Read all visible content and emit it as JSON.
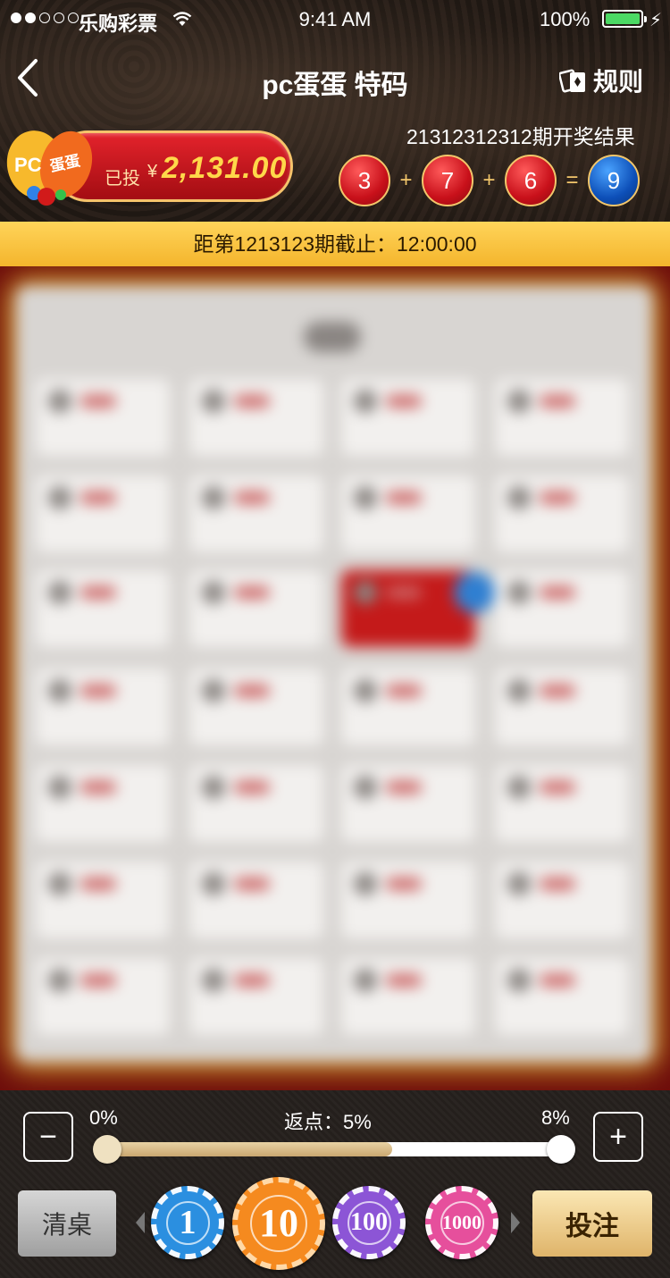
{
  "status_bar": {
    "carrier": "乐购彩票",
    "time": "9:41 AM",
    "battery": "100%"
  },
  "nav": {
    "title": "pc蛋蛋 特码",
    "rules_label": "规则"
  },
  "bet": {
    "logo_text_pc": "PC",
    "logo_text_egg": "蛋蛋",
    "label": "已投",
    "currency": "¥",
    "amount": "2,131.00"
  },
  "result": {
    "title": "21312312312期开奖结果",
    "balls": [
      "3",
      "7",
      "6"
    ],
    "operators": [
      "+",
      "+",
      "="
    ],
    "sum": "9"
  },
  "countdown": {
    "text": "距第1213123期截止：12:00:00"
  },
  "controls": {
    "minus": "−",
    "plus": "+",
    "min_label": "0%",
    "rebate_label": "返点：5%",
    "max_label": "8%",
    "slider_value_pct": 5,
    "slider_max_pct": 8,
    "clear_label": "清桌",
    "submit_label": "投注",
    "chips": [
      "1",
      "10",
      "100",
      "1000"
    ]
  },
  "colors": {
    "accent_red": "#d41a22",
    "gold": "#f2c66b",
    "countdown_bg": "#f9c544"
  }
}
